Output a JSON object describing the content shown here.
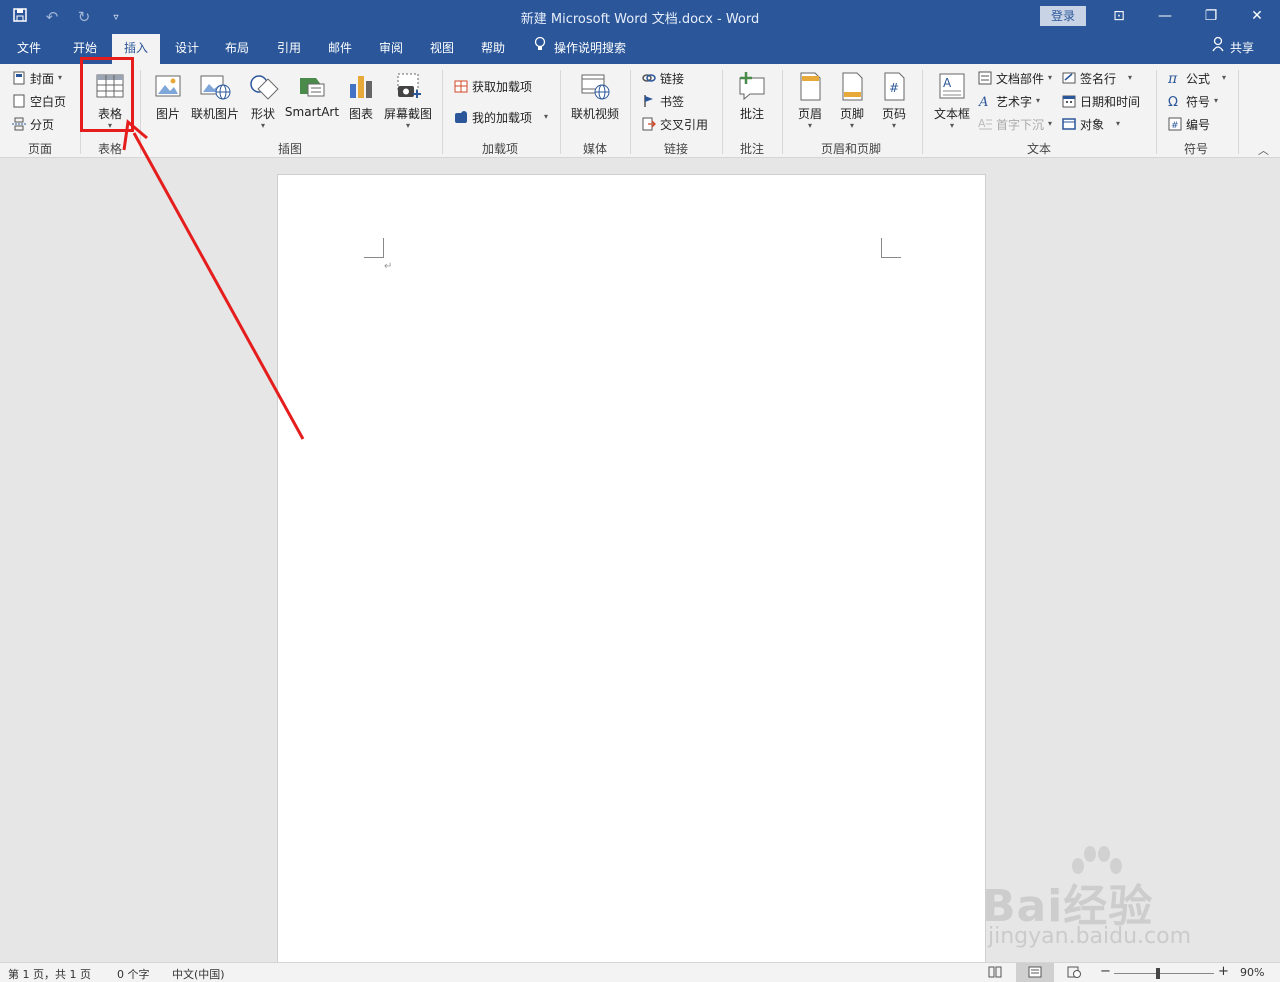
{
  "window": {
    "title": "新建 Microsoft Word 文档.docx  -  Word",
    "login_label": "登录",
    "controls": [
      "⊡",
      "—",
      "❐",
      "✕"
    ]
  },
  "qat": {
    "save_icon": "save-icon",
    "undo_icon": "undo-icon",
    "redo_icon": "redo-icon",
    "customize_icon": "customize-icon"
  },
  "tabs": [
    "文件",
    "开始",
    "插入",
    "设计",
    "布局",
    "引用",
    "邮件",
    "审阅",
    "视图",
    "帮助"
  ],
  "active_tab": "插入",
  "tell_me": "操作说明搜索",
  "share": "共享",
  "ribbon": {
    "pages": {
      "label": "页面",
      "cover": "封面",
      "blank": "空白页",
      "break": "分页"
    },
    "tables": {
      "label": "表格",
      "table": "表格"
    },
    "illustrations": {
      "label": "插图",
      "picture": "图片",
      "online_picture": "联机图片",
      "shapes": "形状",
      "smartart": "SmartArt",
      "chart": "图表",
      "screenshot": "屏幕截图"
    },
    "addins": {
      "label": "加载项",
      "get": "获取加载项",
      "my": "我的加载项"
    },
    "media": {
      "label": "媒体",
      "online_video": "联机视频"
    },
    "links": {
      "label": "链接",
      "link": "链接",
      "bookmark": "书签",
      "crossref": "交叉引用"
    },
    "comments": {
      "label": "批注",
      "comment": "批注"
    },
    "header_footer": {
      "label": "页眉和页脚",
      "header": "页眉",
      "footer": "页脚",
      "page_number": "页码"
    },
    "text": {
      "label": "文本",
      "textbox": "文本框",
      "quickparts": "文档部件",
      "wordart": "艺术字",
      "dropcap": "首字下沉",
      "signature": "签名行",
      "datetime": "日期和时间",
      "object": "对象"
    },
    "symbols": {
      "label": "符号",
      "equation": "公式",
      "symbol": "符号",
      "number": "编号"
    }
  },
  "status": {
    "page": "第 1 页，共 1 页",
    "words": "0 个字",
    "lang": "中文(中国)",
    "zoom": "90%",
    "zoom_level": 0.9
  },
  "watermark": {
    "brand": "Bai经验",
    "url": "jingyan.baidu.com"
  },
  "colors": {
    "word_blue": "#2b579a",
    "ribbon_bg": "#f3f3f3",
    "annotation_red": "#e51d1d"
  }
}
